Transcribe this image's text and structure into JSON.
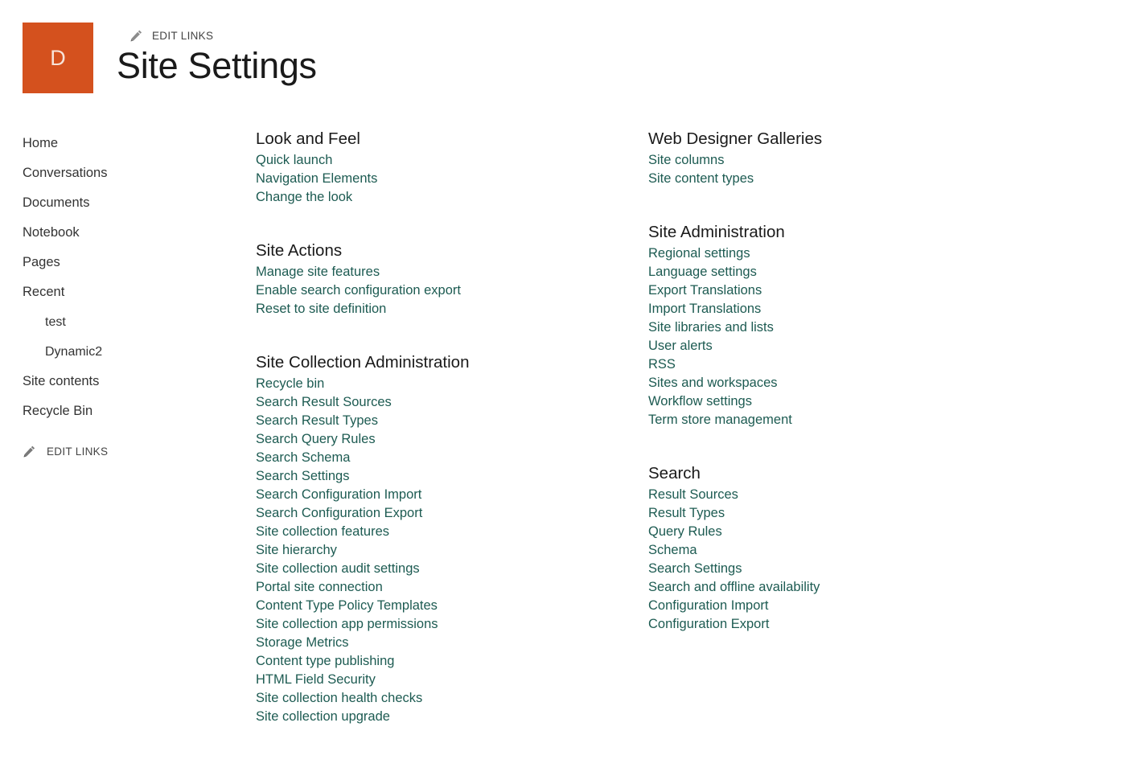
{
  "header": {
    "logo_letter": "D",
    "logo_color": "#d4511e",
    "edit_links_label": "EDIT LINKS",
    "edit_links_icon": "pencil-icon",
    "title": "Site Settings"
  },
  "sidebar": {
    "items": [
      {
        "label": "Home",
        "sub": false
      },
      {
        "label": "Conversations",
        "sub": false
      },
      {
        "label": "Documents",
        "sub": false
      },
      {
        "label": "Notebook",
        "sub": false
      },
      {
        "label": "Pages",
        "sub": false
      },
      {
        "label": "Recent",
        "sub": false
      },
      {
        "label": "test",
        "sub": true
      },
      {
        "label": "Dynamic2",
        "sub": true
      },
      {
        "label": "Site contents",
        "sub": false
      },
      {
        "label": "Recycle Bin",
        "sub": false
      }
    ],
    "edit_links_label": "EDIT LINKS",
    "edit_links_icon": "pencil-icon"
  },
  "link_color": "#1d5b52",
  "columns": [
    {
      "sections": [
        {
          "heading": "Look and Feel",
          "links": [
            "Quick launch",
            "Navigation Elements",
            "Change the look"
          ]
        },
        {
          "heading": "Site Actions",
          "links": [
            "Manage site features",
            "Enable search configuration export",
            "Reset to site definition"
          ]
        },
        {
          "heading": "Site Collection Administration",
          "links": [
            "Recycle bin",
            "Search Result Sources",
            "Search Result Types",
            "Search Query Rules",
            "Search Schema",
            "Search Settings",
            "Search Configuration Import",
            "Search Configuration Export",
            "Site collection features",
            "Site hierarchy",
            "Site collection audit settings",
            "Portal site connection",
            "Content Type Policy Templates",
            "Site collection app permissions",
            "Storage Metrics",
            "Content type publishing",
            "HTML Field Security",
            "Site collection health checks",
            "Site collection upgrade"
          ]
        }
      ]
    },
    {
      "sections": [
        {
          "heading": "Web Designer Galleries",
          "links": [
            "Site columns",
            "Site content types"
          ]
        },
        {
          "heading": "Site Administration",
          "links": [
            "Regional settings",
            "Language settings",
            "Export Translations",
            "Import Translations",
            "Site libraries and lists",
            "User alerts",
            "RSS",
            "Sites and workspaces",
            "Workflow settings",
            "Term store management"
          ]
        },
        {
          "heading": "Search",
          "links": [
            "Result Sources",
            "Result Types",
            "Query Rules",
            "Schema",
            "Search Settings",
            "Search and offline availability",
            "Configuration Import",
            "Configuration Export"
          ]
        }
      ]
    }
  ]
}
